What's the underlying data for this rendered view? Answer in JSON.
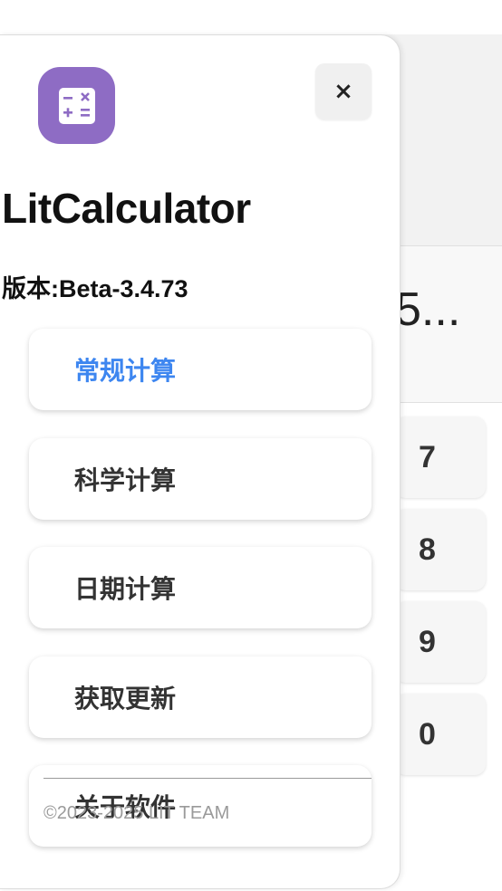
{
  "background": {
    "display_text": "5...",
    "keys": [
      "7",
      "8",
      "9",
      "0"
    ]
  },
  "drawer": {
    "icon": "calculator-icon",
    "close_label": "×",
    "app_name": "LitCalculator",
    "version": "版本:Beta-3.4.73",
    "menu": [
      {
        "label": "常规计算",
        "active": true
      },
      {
        "label": "科学计算",
        "active": false
      },
      {
        "label": "日期计算",
        "active": false
      },
      {
        "label": "获取更新",
        "active": false
      },
      {
        "label": "关于软件",
        "active": false
      }
    ],
    "footer": "©2023-2025 LIT TEAM"
  },
  "colors": {
    "accent": "#3d86f0",
    "icon_bg": "#8e6cc4"
  }
}
